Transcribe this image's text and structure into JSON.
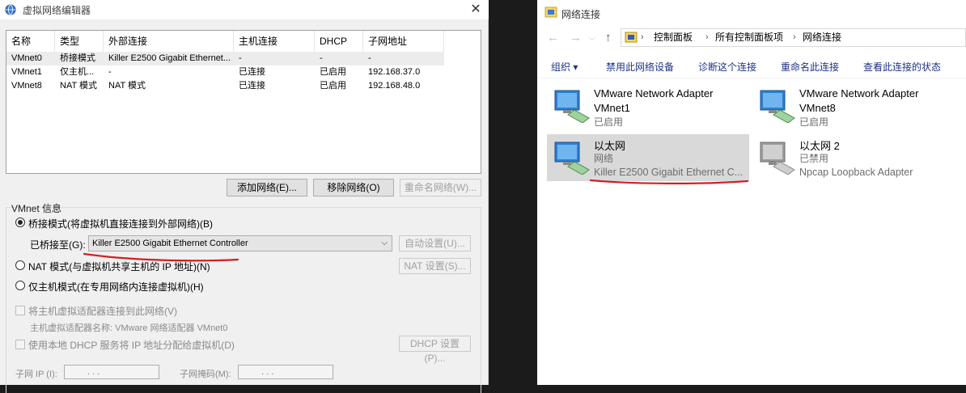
{
  "vmware_editor": {
    "title": "虚拟网络编辑器",
    "columns": [
      "名称",
      "类型",
      "外部连接",
      "主机连接",
      "DHCP",
      "子网地址"
    ],
    "rows": [
      {
        "name": "VMnet0",
        "type": "桥接模式",
        "external": "Killer E2500 Gigabit Ethernet...",
        "host": "-",
        "dhcp": "-",
        "subnet": "-"
      },
      {
        "name": "VMnet1",
        "type": "仅主机...",
        "external": "-",
        "host": "已连接",
        "dhcp": "已启用",
        "subnet": "192.168.37.0"
      },
      {
        "name": "VMnet8",
        "type": "NAT 模式",
        "external": "NAT 模式",
        "host": "已连接",
        "dhcp": "已启用",
        "subnet": "192.168.48.0"
      }
    ],
    "buttons": {
      "add": "添加网络(E)...",
      "remove": "移除网络(O)",
      "rename": "重命名网络(W)..."
    },
    "info_group": "VMnet 信息",
    "bridge_radio": "桥接模式(将虚拟机直接连接到外部网络)(B)",
    "bridged_to_label": "已桥接至(G):",
    "bridged_to_value": "Killer E2500 Gigabit Ethernet Controller",
    "auto_settings": "自动设置(U)...",
    "nat_radio": "NAT 模式(与虚拟机共享主机的 IP 地址)(N)",
    "nat_settings": "NAT 设置(S)...",
    "hostonly_radio": "仅主机模式(在专用网络内连接虚拟机)(H)",
    "connect_host_adapter": "将主机虚拟适配器连接到此网络(V)",
    "host_adapter_name": "主机虚拟适配器名称: VMware 网络适配器 VMnet0",
    "use_dhcp": "使用本地 DHCP 服务将 IP 地址分配给虚拟机(D)",
    "dhcp_settings": "DHCP 设置(P)...",
    "subnet_ip_label": "子网 IP (I):",
    "subnet_mask_label": "子网掩码(M):",
    "ip_placeholder": ".      .      ."
  },
  "network_connections": {
    "title": "网络连接",
    "breadcrumb": [
      "控制面板",
      "所有控制面板项",
      "网络连接"
    ],
    "commands": [
      "组织 ▾",
      "禁用此网络设备",
      "诊断这个连接",
      "重命名此连接",
      "查看此连接的状态"
    ],
    "adapters": [
      {
        "name": "VMware Network Adapter",
        "line2": "VMnet1",
        "line3": "已启用"
      },
      {
        "name": "VMware Network Adapter",
        "line2": "VMnet8",
        "line3": "已启用"
      },
      {
        "name": "以太网",
        "line2": "网络",
        "line3": "Killer E2500 Gigabit Ethernet C..."
      },
      {
        "name": "以太网 2",
        "line2": "已禁用",
        "line3": "Npcap Loopback Adapter"
      }
    ]
  },
  "colors": {
    "accent_red": "#d21f1f",
    "command_blue": "#1e3287"
  }
}
